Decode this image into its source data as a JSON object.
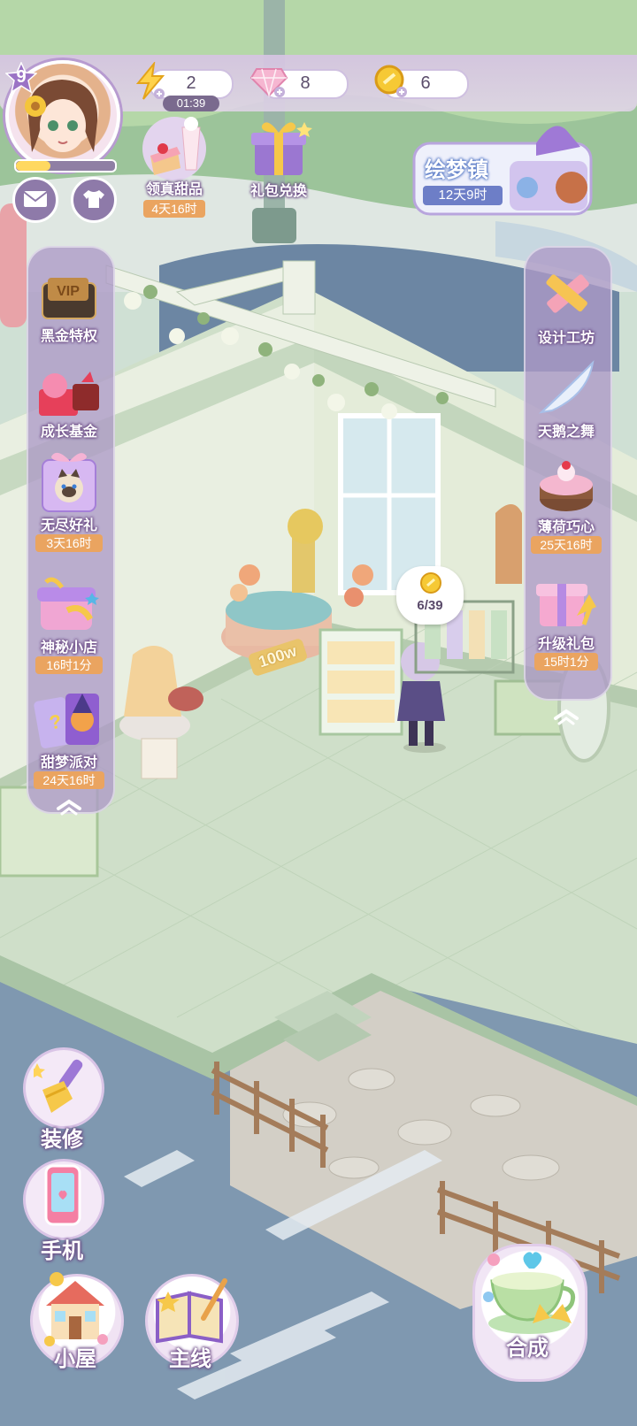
{
  "player": {
    "level": "9",
    "xp_fraction": 0.35
  },
  "resources": {
    "energy": "2",
    "gems": "8",
    "coins": "6",
    "energy_timer": "01:39"
  },
  "top_events": [
    {
      "label": "领真甜品",
      "time": "4天16时"
    },
    {
      "label": "礼包兑换"
    }
  ],
  "huimeng": {
    "title": "绘梦镇",
    "time": "12天9时"
  },
  "left_panel": [
    {
      "label": "黑金特权",
      "badge": "VIP"
    },
    {
      "label": "成长基金"
    },
    {
      "label": "无尽好礼",
      "time": "3天16时"
    },
    {
      "label": "神秘小店",
      "time": "16时1分"
    },
    {
      "label": "甜梦派对",
      "time": "24天16时"
    }
  ],
  "right_panel": [
    {
      "label": "设计工坊"
    },
    {
      "label": "天鹅之舞"
    },
    {
      "label": "薄荷巧心",
      "time": "25天16时"
    },
    {
      "label": "升级礼包",
      "time": "15时1分"
    }
  ],
  "scene": {
    "coin_bubble": "6/39",
    "fountain_badge": "100w"
  },
  "bottom_left": [
    {
      "label": "装修"
    },
    {
      "label": "手机"
    }
  ],
  "bottom_nav": [
    {
      "label": "小屋"
    },
    {
      "label": "主线"
    },
    {
      "label": "合成"
    }
  ],
  "colors": {
    "panel": "#ad9ac6",
    "time_tag": "#eaa460",
    "accent": "#8e7aa9"
  }
}
